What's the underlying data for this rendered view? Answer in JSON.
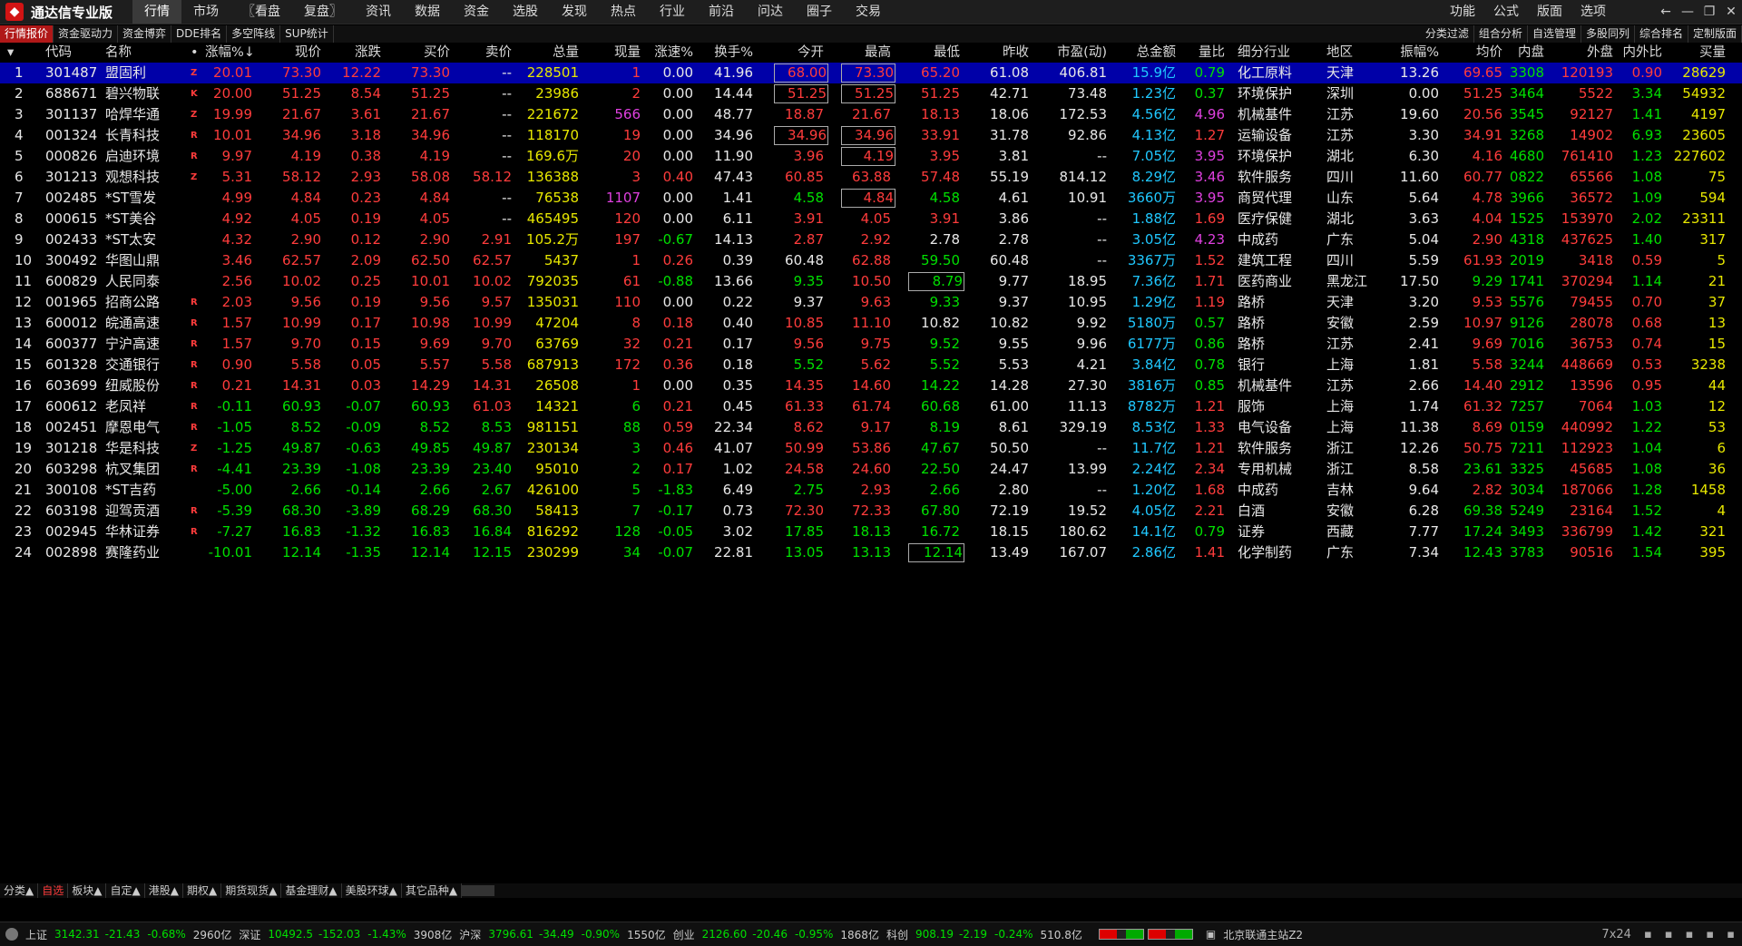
{
  "app": {
    "title": "通达信专业版"
  },
  "menu": [
    "行情",
    "市场",
    "〖看盘",
    "复盘〗",
    "资讯",
    "数据",
    "资金",
    "选股",
    "发现",
    "热点",
    "行业",
    "前沿",
    "问达",
    "圈子",
    "交易"
  ],
  "menu_right": [
    "功能",
    "公式",
    "版面",
    "选项"
  ],
  "toolbar_left": [
    "行情报价",
    "资金驱动力",
    "资金博弈",
    "DDE排名",
    "多空阵线",
    "SUP统计"
  ],
  "toolbar_right": [
    "分类过滤",
    "组合分析",
    "自选管理",
    "多股同列",
    "综合排名",
    "定制版面"
  ],
  "columns": [
    "代码",
    "名称",
    "•",
    "涨幅%↓",
    "现价",
    "涨跌",
    "买价",
    "卖价",
    "总量",
    "现量",
    "涨速%",
    "换手%",
    "今开",
    "最高",
    "最低",
    "昨收",
    "市盈(动)",
    "总金额",
    "量比",
    "细分行业",
    "地区",
    "振幅%",
    "均价",
    "内盘",
    "外盘",
    "内外比",
    "买量"
  ],
  "colors": {
    "up": "#ff3c3c",
    "down": "#00e000",
    "flat": "#e8e8e8",
    "volume": "#e8e800",
    "amount": "#20c8ff",
    "selected_row": "#0000a8"
  },
  "rows": [
    [
      "1",
      "301487",
      "盟固利",
      "Z",
      "20.01",
      "73.30",
      "12.22",
      "73.30",
      "--",
      "228501",
      "1",
      "0.00",
      "41.96",
      "68.00",
      "73.30",
      "65.20",
      "61.08",
      "406.81",
      "15.9亿",
      "0.79",
      "化工原料",
      "天津",
      "13.26",
      "69.65",
      "3308",
      "120193",
      "0.90",
      "28629"
    ],
    [
      "2",
      "688671",
      "碧兴物联",
      "K",
      "20.00",
      "51.25",
      "8.54",
      "51.25",
      "--",
      "23986",
      "2",
      "0.00",
      "14.44",
      "51.25",
      "51.25",
      "51.25",
      "42.71",
      "73.48",
      "1.23亿",
      "0.37",
      "环境保护",
      "深圳",
      "0.00",
      "51.25",
      "3464",
      "5522",
      "3.34",
      "54932"
    ],
    [
      "3",
      "301137",
      "哈焊华通",
      "Z",
      "19.99",
      "21.67",
      "3.61",
      "21.67",
      "--",
      "221672",
      "566",
      "0.00",
      "48.77",
      "18.87",
      "21.67",
      "18.13",
      "18.06",
      "172.53",
      "4.56亿",
      "4.96",
      "机械基件",
      "江苏",
      "19.60",
      "20.56",
      "3545",
      "92127",
      "1.41",
      "4197"
    ],
    [
      "4",
      "001324",
      "长青科技",
      "R",
      "10.01",
      "34.96",
      "3.18",
      "34.96",
      "--",
      "118170",
      "19",
      "0.00",
      "34.96",
      "34.96",
      "34.96",
      "33.91",
      "31.78",
      "92.86",
      "4.13亿",
      "1.27",
      "运输设备",
      "江苏",
      "3.30",
      "34.91",
      "3268",
      "14902",
      "6.93",
      "23605"
    ],
    [
      "5",
      "000826",
      "启迪环境",
      "R",
      "9.97",
      "4.19",
      "0.38",
      "4.19",
      "--",
      "169.6万",
      "20",
      "0.00",
      "11.90",
      "3.96",
      "4.19",
      "3.95",
      "3.81",
      "--",
      "7.05亿",
      "3.95",
      "环境保护",
      "湖北",
      "6.30",
      "4.16",
      "4680",
      "761410",
      "1.23",
      "227602"
    ],
    [
      "6",
      "301213",
      "观想科技",
      "Z",
      "5.31",
      "58.12",
      "2.93",
      "58.08",
      "58.12",
      "136388",
      "3",
      "0.40",
      "47.43",
      "60.85",
      "63.88",
      "57.48",
      "55.19",
      "814.12",
      "8.29亿",
      "3.46",
      "软件服务",
      "四川",
      "11.60",
      "60.77",
      "0822",
      "65566",
      "1.08",
      "75"
    ],
    [
      "7",
      "002485",
      "*ST雪发",
      "",
      "4.99",
      "4.84",
      "0.23",
      "4.84",
      "--",
      "76538",
      "1107",
      "0.00",
      "1.41",
      "4.58",
      "4.84",
      "4.58",
      "4.61",
      "10.91",
      "3660万",
      "3.95",
      "商贸代理",
      "山东",
      "5.64",
      "4.78",
      "3966",
      "36572",
      "1.09",
      "594"
    ],
    [
      "8",
      "000615",
      "*ST美谷",
      "",
      "4.92",
      "4.05",
      "0.19",
      "4.05",
      "--",
      "465495",
      "120",
      "0.00",
      "6.11",
      "3.91",
      "4.05",
      "3.91",
      "3.86",
      "--",
      "1.88亿",
      "1.69",
      "医疗保健",
      "湖北",
      "3.63",
      "4.04",
      "1525",
      "153970",
      "2.02",
      "23311"
    ],
    [
      "9",
      "002433",
      "*ST太安",
      "",
      "4.32",
      "2.90",
      "0.12",
      "2.90",
      "2.91",
      "105.2万",
      "197",
      "-0.67",
      "14.13",
      "2.87",
      "2.92",
      "2.78",
      "2.78",
      "--",
      "3.05亿",
      "4.23",
      "中成药",
      "广东",
      "5.04",
      "2.90",
      "4318",
      "437625",
      "1.40",
      "317"
    ],
    [
      "10",
      "300492",
      "华图山鼎",
      "",
      "3.46",
      "62.57",
      "2.09",
      "62.50",
      "62.57",
      "5437",
      "1",
      "0.26",
      "0.39",
      "60.48",
      "62.88",
      "59.50",
      "60.48",
      "--",
      "3367万",
      "1.52",
      "建筑工程",
      "四川",
      "5.59",
      "61.93",
      "2019",
      "3418",
      "0.59",
      "5"
    ],
    [
      "11",
      "600829",
      "人民同泰",
      "",
      "2.56",
      "10.02",
      "0.25",
      "10.01",
      "10.02",
      "792035",
      "61",
      "-0.88",
      "13.66",
      "9.35",
      "10.50",
      "8.79",
      "9.77",
      "18.95",
      "7.36亿",
      "1.71",
      "医药商业",
      "黑龙江",
      "17.50",
      "9.29",
      "1741",
      "370294",
      "1.14",
      "21"
    ],
    [
      "12",
      "001965",
      "招商公路",
      "R",
      "2.03",
      "9.56",
      "0.19",
      "9.56",
      "9.57",
      "135031",
      "110",
      "0.00",
      "0.22",
      "9.37",
      "9.63",
      "9.33",
      "9.37",
      "10.95",
      "1.29亿",
      "1.19",
      "路桥",
      "天津",
      "3.20",
      "9.53",
      "5576",
      "79455",
      "0.70",
      "37"
    ],
    [
      "13",
      "600012",
      "皖通高速",
      "R",
      "1.57",
      "10.99",
      "0.17",
      "10.98",
      "10.99",
      "47204",
      "8",
      "0.18",
      "0.40",
      "10.85",
      "11.10",
      "10.82",
      "10.82",
      "9.92",
      "5180万",
      "0.57",
      "路桥",
      "安徽",
      "2.59",
      "10.97",
      "9126",
      "28078",
      "0.68",
      "13"
    ],
    [
      "14",
      "600377",
      "宁沪高速",
      "R",
      "1.57",
      "9.70",
      "0.15",
      "9.69",
      "9.70",
      "63769",
      "32",
      "0.21",
      "0.17",
      "9.56",
      "9.75",
      "9.52",
      "9.55",
      "9.96",
      "6177万",
      "0.86",
      "路桥",
      "江苏",
      "2.41",
      "9.69",
      "7016",
      "36753",
      "0.74",
      "15"
    ],
    [
      "15",
      "601328",
      "交通银行",
      "R",
      "0.90",
      "5.58",
      "0.05",
      "5.57",
      "5.58",
      "687913",
      "172",
      "0.36",
      "0.18",
      "5.52",
      "5.62",
      "5.52",
      "5.53",
      "4.21",
      "3.84亿",
      "0.78",
      "银行",
      "上海",
      "1.81",
      "5.58",
      "3244",
      "448669",
      "0.53",
      "3238"
    ],
    [
      "16",
      "603699",
      "纽威股份",
      "R",
      "0.21",
      "14.31",
      "0.03",
      "14.29",
      "14.31",
      "26508",
      "1",
      "0.00",
      "0.35",
      "14.35",
      "14.60",
      "14.22",
      "14.28",
      "27.30",
      "3816万",
      "0.85",
      "机械基件",
      "江苏",
      "2.66",
      "14.40",
      "2912",
      "13596",
      "0.95",
      "44"
    ],
    [
      "17",
      "600612",
      "老凤祥",
      "R",
      "-0.11",
      "60.93",
      "-0.07",
      "60.93",
      "61.03",
      "14321",
      "6",
      "0.21",
      "0.45",
      "61.33",
      "61.74",
      "60.68",
      "61.00",
      "11.13",
      "8782万",
      "1.21",
      "服饰",
      "上海",
      "1.74",
      "61.32",
      "7257",
      "7064",
      "1.03",
      "12"
    ],
    [
      "18",
      "002451",
      "摩恩电气",
      "R",
      "-1.05",
      "8.52",
      "-0.09",
      "8.52",
      "8.53",
      "981151",
      "88",
      "0.59",
      "22.34",
      "8.62",
      "9.17",
      "8.19",
      "8.61",
      "329.19",
      "8.53亿",
      "1.33",
      "电气设备",
      "上海",
      "11.38",
      "8.69",
      "0159",
      "440992",
      "1.22",
      "53"
    ],
    [
      "19",
      "301218",
      "华是科技",
      "Z",
      "-1.25",
      "49.87",
      "-0.63",
      "49.85",
      "49.87",
      "230134",
      "3",
      "0.46",
      "41.07",
      "50.99",
      "53.86",
      "47.67",
      "50.50",
      "--",
      "11.7亿",
      "1.21",
      "软件服务",
      "浙江",
      "12.26",
      "50.75",
      "7211",
      "112923",
      "1.04",
      "6"
    ],
    [
      "20",
      "603298",
      "杭叉集团",
      "R",
      "-4.41",
      "23.39",
      "-1.08",
      "23.39",
      "23.40",
      "95010",
      "2",
      "0.17",
      "1.02",
      "24.58",
      "24.60",
      "22.50",
      "24.47",
      "13.99",
      "2.24亿",
      "2.34",
      "专用机械",
      "浙江",
      "8.58",
      "23.61",
      "3325",
      "45685",
      "1.08",
      "36"
    ],
    [
      "21",
      "300108",
      "*ST吉药",
      "",
      "-5.00",
      "2.66",
      "-0.14",
      "2.66",
      "2.67",
      "426100",
      "5",
      "-1.83",
      "6.49",
      "2.75",
      "2.93",
      "2.66",
      "2.80",
      "--",
      "1.20亿",
      "1.68",
      "中成药",
      "吉林",
      "9.64",
      "2.82",
      "3034",
      "187066",
      "1.28",
      "1458"
    ],
    [
      "22",
      "603198",
      "迎驾贡酒",
      "R",
      "-5.39",
      "68.30",
      "-3.89",
      "68.29",
      "68.30",
      "58413",
      "7",
      "-0.17",
      "0.73",
      "72.30",
      "72.33",
      "67.80",
      "72.19",
      "19.52",
      "4.05亿",
      "2.21",
      "白酒",
      "安徽",
      "6.28",
      "69.38",
      "5249",
      "23164",
      "1.52",
      "4"
    ],
    [
      "23",
      "002945",
      "华林证券",
      "R",
      "-7.27",
      "16.83",
      "-1.32",
      "16.83",
      "16.84",
      "816292",
      "128",
      "-0.05",
      "3.02",
      "17.85",
      "18.13",
      "16.72",
      "18.15",
      "180.62",
      "14.1亿",
      "0.79",
      "证券",
      "西藏",
      "7.77",
      "17.24",
      "3493",
      "336799",
      "1.42",
      "321"
    ],
    [
      "24",
      "002898",
      "赛隆药业",
      "",
      "-10.01",
      "12.14",
      "-1.35",
      "12.14",
      "12.15",
      "230299",
      "34",
      "-0.07",
      "22.81",
      "13.05",
      "13.13",
      "12.14",
      "13.49",
      "167.07",
      "2.86亿",
      "1.41",
      "化学制药",
      "广东",
      "7.34",
      "12.43",
      "3783",
      "90516",
      "1.54",
      "395"
    ]
  ],
  "bottom_tabs": [
    "分类▲",
    "自选",
    "板块▲",
    "自定▲",
    "港股▲",
    "期权▲",
    "期货现货▲",
    "基金理财▲",
    "美股环球▲",
    "其它品种▲"
  ],
  "status": [
    {
      "name": "上证",
      "value": "3142.31",
      "change": "-21.43",
      "pct": "-0.68%",
      "amount": "2960亿"
    },
    {
      "name": "深证",
      "value": "10492.5",
      "change": "-152.03",
      "pct": "-1.43%",
      "amount": "3908亿"
    },
    {
      "name": "沪深",
      "value": "3796.61",
      "change": "-34.49",
      "pct": "-0.90%",
      "amount": "1550亿"
    },
    {
      "name": "创业",
      "value": "2126.60",
      "change": "-20.46",
      "pct": "-0.95%",
      "amount": "1868亿"
    },
    {
      "name": "科创",
      "value": "908.19",
      "change": "-2.19",
      "pct": "-0.24%",
      "amount": "510.8亿"
    }
  ],
  "server": "北京联通主站Z2",
  "clock_mode": "7x24"
}
